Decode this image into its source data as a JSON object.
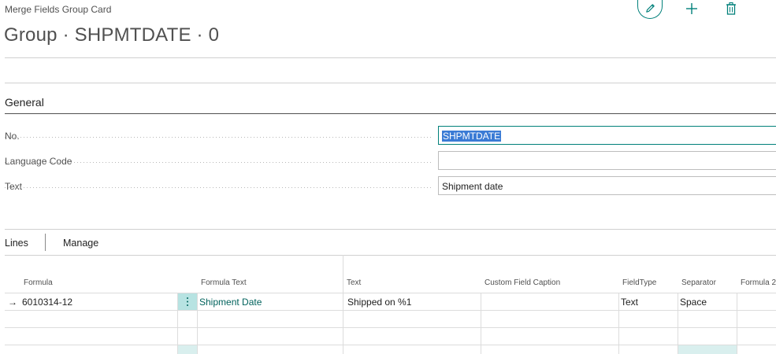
{
  "header": {
    "caption": "Merge Fields Group Card",
    "title": "Group · SHPMTDATE · 0"
  },
  "actions": {
    "edit_icon": "pencil-icon",
    "new_icon": "plus-icon",
    "delete_icon": "trash-icon"
  },
  "general": {
    "section_title": "General",
    "fields": [
      {
        "label": "No.",
        "value": "SHPMTDATE"
      },
      {
        "label": "Language Code",
        "value": ""
      },
      {
        "label": "Text",
        "value": "Shipment date"
      }
    ]
  },
  "lines": {
    "tabs": [
      "Lines",
      "Manage"
    ],
    "columns": [
      "Formula",
      "Formula Text",
      "Text",
      "Custom Field Caption",
      "FieldType",
      "Separator",
      "Formula 2"
    ],
    "rows": [
      {
        "formula": "6010314-12",
        "formula_text": "Shipment Date",
        "text": "Shipped on %1",
        "custom_field_caption": "",
        "field_type": "Text",
        "separator": "Space",
        "formula2": ""
      },
      {
        "formula": "",
        "formula_text": "",
        "text": "",
        "custom_field_caption": "",
        "field_type": "",
        "separator": "",
        "formula2": ""
      },
      {
        "formula": "",
        "formula_text": "",
        "text": "",
        "custom_field_caption": "",
        "field_type": "",
        "separator": "",
        "formula2": ""
      }
    ],
    "current_row_indicator": "→"
  },
  "colors": {
    "accent": "#00807a",
    "selection": "#3a7bd5",
    "highlight_cell": "#b7e3e2"
  }
}
